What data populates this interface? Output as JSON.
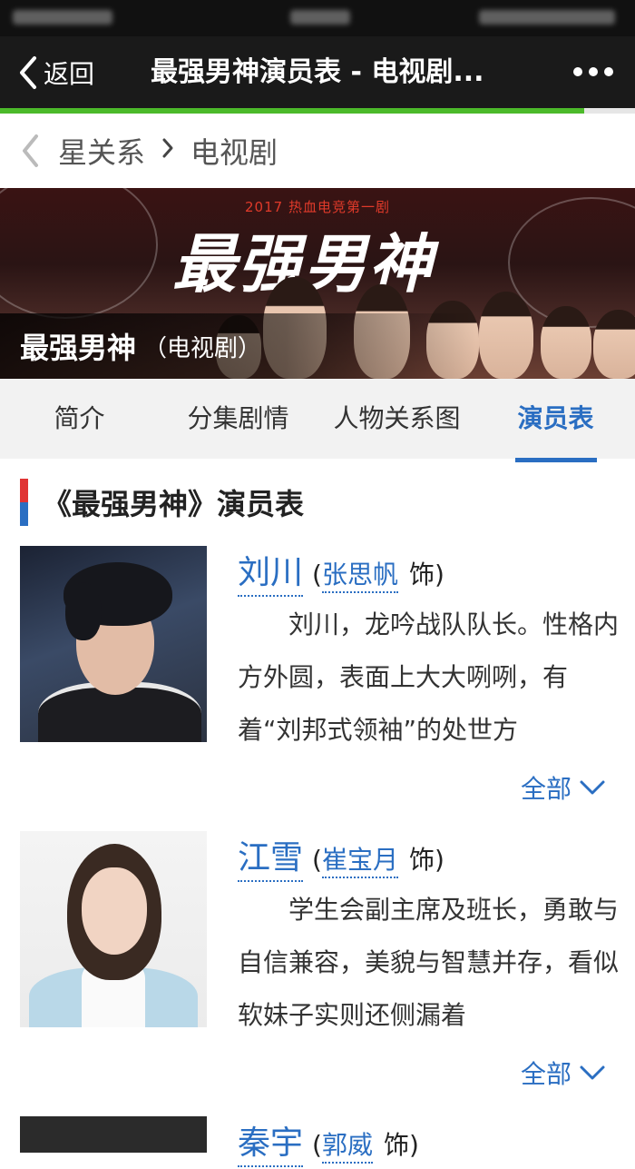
{
  "nav": {
    "back_label": "返回",
    "title": "最强男神演员表 - 电视剧...",
    "progress_percent": 92
  },
  "breadcrumb": {
    "items": [
      "星关系",
      "电视剧"
    ]
  },
  "banner": {
    "tagline": "2017 热血电竞第一剧",
    "logo_text": "最强男神",
    "caption_title": "最强男神",
    "caption_sub": "（电视剧）"
  },
  "tabs": [
    {
      "label": "简介",
      "active": false
    },
    {
      "label": "分集剧情",
      "active": false
    },
    {
      "label": "人物关系图",
      "active": false
    },
    {
      "label": "演员表",
      "active": true
    }
  ],
  "section": {
    "title": "《最强男神》演员表"
  },
  "cast": [
    {
      "character": "刘川",
      "actor": "张思帆",
      "role_suffix": "饰)",
      "description": "刘川，龙吟战队队长。性格内方外圆，表面上大大咧咧，有着“刘邦式领袖”的处世方",
      "more_label": "全部"
    },
    {
      "character": "江雪",
      "actor": "崔宝月",
      "role_suffix": "饰)",
      "description": "学生会副主席及班长，勇敢与自信兼容，美貌与智慧并存，看似软妹子实则还侧漏着",
      "more_label": "全部"
    },
    {
      "character": "秦宇",
      "actor": "郭威",
      "role_suffix": "饰)"
    }
  ],
  "colors": {
    "accent_blue": "#2a6ec2",
    "progress_green": "#4cba2a",
    "nav_bg": "#1a1a1a"
  }
}
